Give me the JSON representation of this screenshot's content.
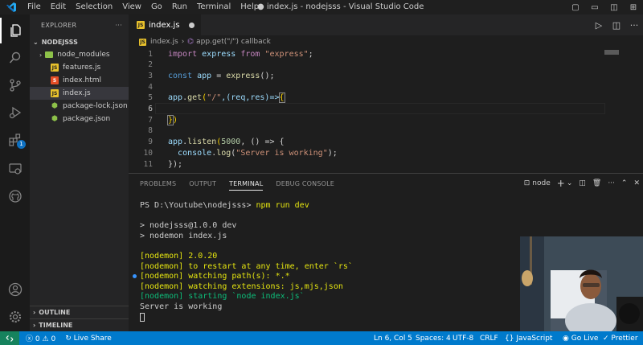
{
  "menu": [
    "File",
    "Edit",
    "Selection",
    "View",
    "Go",
    "Run",
    "Terminal",
    "Help"
  ],
  "window_title": "● index.js - nodejsss - Visual Studio Code",
  "explorer": {
    "title": "EXPLORER",
    "folder": "NODEJSSS",
    "items": [
      {
        "label": "node_modules",
        "icon": "folder-icon"
      },
      {
        "label": "features.js",
        "icon": "js-file-icon"
      },
      {
        "label": "index.html",
        "icon": "html-file-icon"
      },
      {
        "label": "index.js",
        "icon": "js-file-icon"
      },
      {
        "label": "package-lock.json",
        "icon": "json-file-icon"
      },
      {
        "label": "package.json",
        "icon": "json-file-icon"
      }
    ],
    "outline": "OUTLINE",
    "timeline": "TIMELINE"
  },
  "activity_badge": "1",
  "tab": {
    "label": "index.js"
  },
  "breadcrumb": {
    "file": "index.js",
    "symbol": "app.get(\"/\") callback"
  },
  "editor": {
    "line_numbers": [
      "1",
      "2",
      "3",
      "4",
      "5",
      "6",
      "7",
      "8",
      "9",
      "10",
      "11"
    ],
    "line1": {
      "kw": "import",
      "name": "express",
      "from": "from",
      "str": "\"express\"",
      "end": ";"
    },
    "line3": {
      "kw": "const",
      "name": "app",
      "eq": " = ",
      "fn": "express",
      "end": "();"
    },
    "line5": {
      "obj": "app",
      "fn": "get",
      "open": "(",
      "str": "\"/\"",
      "args": ",(req,res)=>",
      "brace": "{"
    },
    "line7": {
      "brace": "}",
      "end": ")"
    },
    "line9": {
      "obj": "app",
      "fn": "listen",
      "open": "(",
      "num": "5000",
      "rest": ", () => {"
    },
    "line10": {
      "obj": "console",
      "fn": "log",
      "open": "(",
      "str": "\"Server is working\"",
      "end": ");"
    },
    "line11": {
      "text": "});"
    }
  },
  "panel": {
    "tabs": [
      "PROBLEMS",
      "OUTPUT",
      "TERMINAL",
      "DEBUG CONSOLE"
    ],
    "active_tab": "TERMINAL",
    "terminal_name": "node",
    "terminal": {
      "prompt": "PS D:\\Youtube\\nodejsss> ",
      "command": "npm run dev",
      "out1": "> nodejsss@1.0.0 dev",
      "out2": "> nodemon index.js",
      "nm1": "[nodemon] 2.0.20",
      "nm2": "[nodemon] to restart at any time, enter `rs`",
      "nm3": "[nodemon] watching path(s): *.*",
      "nm4": "[nodemon] watching extensions: js,mjs,json",
      "nm5": "[nodemon] starting `node index.js`",
      "out3": "Server is working"
    }
  },
  "status": {
    "errors": "0",
    "warnings": "0",
    "live_share": "Live Share",
    "position": "Ln 6, Col 5",
    "spaces": "Spaces: 4",
    "encoding": "UTF-8",
    "eol": "CRLF",
    "language": "JavaScript",
    "go_live": "Go Live",
    "prettier": "Prettier"
  },
  "colors": {
    "status_bar": "#007acc",
    "accent": "#0e70c0",
    "js_icon": "#e8c12c",
    "terminal_yellow": "#e5e510",
    "terminal_green": "#0dbc79"
  }
}
